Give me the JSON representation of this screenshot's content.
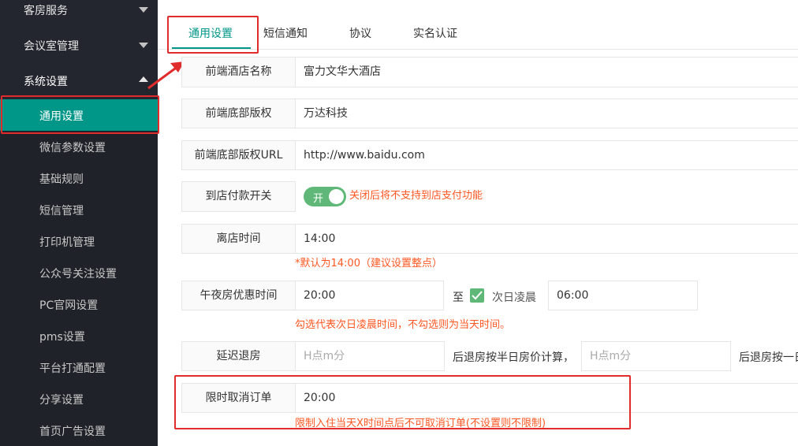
{
  "sidebar": {
    "items": [
      {
        "label": "客房服务"
      },
      {
        "label": "会议室管理"
      },
      {
        "label": "系统设置"
      }
    ],
    "subitems": [
      {
        "label": "通用设置"
      },
      {
        "label": "微信参数设置"
      },
      {
        "label": "基础规则"
      },
      {
        "label": "短信管理"
      },
      {
        "label": "打印机管理"
      },
      {
        "label": "公众号关注设置"
      },
      {
        "label": "PC官网设置"
      },
      {
        "label": "pms设置"
      },
      {
        "label": "平台打通配置"
      },
      {
        "label": "分享设置"
      },
      {
        "label": "首页广告设置"
      }
    ]
  },
  "tabs": [
    "通用设置",
    "短信通知",
    "协议",
    "实名认证"
  ],
  "form": {
    "hotel_name": {
      "label": "前端酒店名称",
      "value": "富力文华大酒店"
    },
    "copyright": {
      "label": "前端底部版权",
      "value": "万达科技"
    },
    "copyright_url": {
      "label": "前端底部版权URL",
      "value": "http://www.baidu.com"
    },
    "pay_on_arrival": {
      "label": "到店付款开关",
      "toggle": "开",
      "hint": "关闭后将不支持到店支付功能"
    },
    "checkout_time": {
      "label": "离店时间",
      "value": "14:00",
      "hint": "*默认为14:00（建议设置整点）"
    },
    "midnight": {
      "label": "午夜房优惠时间",
      "start": "20:00",
      "to": "至",
      "next_day": "次日凌晨",
      "end": "06:00",
      "hint": "勾选代表次日凌晨时间，不勾选则为当天时间。"
    },
    "late_checkout": {
      "label": "延迟退房",
      "placeholder1": "H点m分",
      "text1": "后退房按半日房价计算，",
      "placeholder2": "H点m分",
      "text2": "后退房按一日"
    },
    "cancel_limit": {
      "label": "限时取消订单",
      "value": "20:00",
      "hint": "限制入住当天X时间点后不可取消订单(不设置则不限制)"
    }
  },
  "colors": {
    "accent": "#009688",
    "highlight": "#e02c2c",
    "hint": "#ff5722",
    "toggle": "#5fb878",
    "sidebar": "#23262e"
  }
}
